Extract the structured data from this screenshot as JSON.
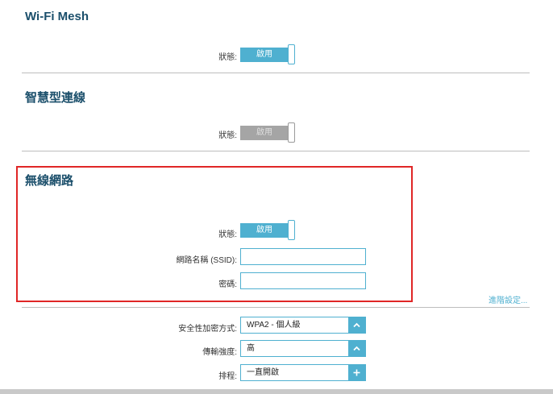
{
  "wifi_mesh": {
    "title": "Wi-Fi Mesh",
    "status_label": "狀態:",
    "toggle_label": "啟用"
  },
  "smart_connect": {
    "title": "智慧型連線",
    "status_label": "狀態:",
    "toggle_label": "啟用"
  },
  "wireless": {
    "title": "無線網路",
    "status_label": "狀態:",
    "toggle_label": "啟用",
    "ssid_label": "網路名稱 (SSID):",
    "ssid_value": "",
    "password_label": "密碼:",
    "password_value": "",
    "advanced_link": "進階設定..."
  },
  "advanced": {
    "security_label": "安全性加密方式:",
    "security_value": "WPA2 - 個人級",
    "power_label": "傳輸強度:",
    "power_value": "高",
    "schedule_label": "排程:",
    "schedule_value": "一直開啟"
  },
  "colors": {
    "accent": "#4fb0d0",
    "title": "#1b4f6b",
    "disabled": "#a5a5a5",
    "highlight": "#e02626"
  }
}
